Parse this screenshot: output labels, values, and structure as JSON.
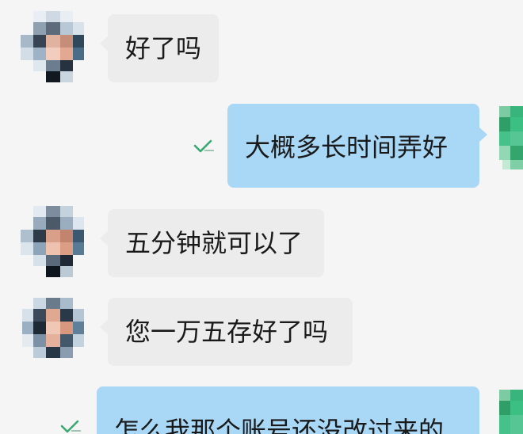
{
  "messages": [
    {
      "direction": "in",
      "text": "好了吗"
    },
    {
      "direction": "out",
      "text": "大概多长时间弄好",
      "status_icon": "read-check-icon"
    },
    {
      "direction": "in",
      "text": "五分钟就可以了"
    },
    {
      "direction": "in",
      "text": "您一万五存好了吗"
    },
    {
      "direction": "out",
      "text": "怎么我那个账号还没改过来的",
      "status_icon": "read-check-icon"
    }
  ],
  "colors": {
    "background": "#f5f5f5",
    "incoming_bubble": "#ececec",
    "outgoing_bubble": "#a9d7f6",
    "read_check": "#3aa872",
    "self_avatar": "#39b47a"
  }
}
